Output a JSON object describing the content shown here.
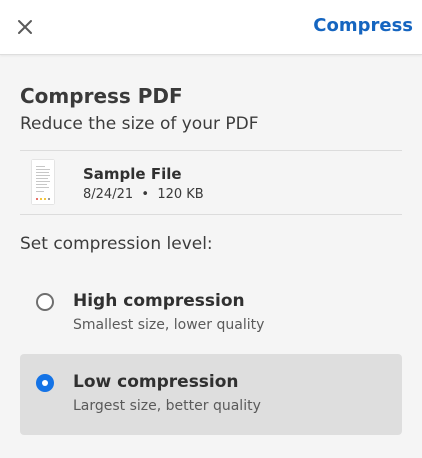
{
  "header": {
    "close_icon": "close-icon",
    "action_label": "Compress",
    "accent_color": "#1565c0"
  },
  "page": {
    "title": "Compress PDF",
    "subtitle": "Reduce the size of your PDF"
  },
  "file": {
    "name": "Sample File",
    "date": "8/24/21",
    "separator": "•",
    "size": "120 KB"
  },
  "compression": {
    "label": "Set compression level:",
    "selected": "low",
    "options": [
      {
        "id": "high",
        "title": "High compression",
        "description": "Smallest size, lower quality"
      },
      {
        "id": "low",
        "title": "Low compression",
        "description": "Largest size, better quality"
      }
    ],
    "selected_color": "#1473e6"
  }
}
